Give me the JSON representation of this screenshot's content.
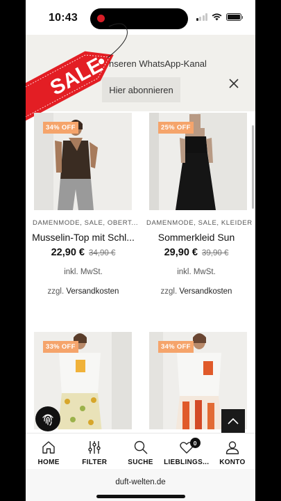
{
  "status": {
    "time": "10:43"
  },
  "banner": {
    "text": "nseren WhatsApp-Kanal",
    "button": "Hier abonnieren"
  },
  "sale_tag": {
    "text": "SALE",
    "colors": {
      "tag": "#e31e24",
      "text": "#ffffff"
    }
  },
  "products": [
    {
      "badge": "34% OFF",
      "category": "DAMENMODE, SALE, OBERT...",
      "name": "Musselin-Top mit Schl...",
      "price": "22,90 €",
      "old_price": "34,90 €",
      "vat": "inkl. MwSt.",
      "ship_prefix": "zzgl.",
      "ship_link": "Versandkosten"
    },
    {
      "badge": "25% OFF",
      "category": "DAMENMODE, SALE, KLEIDER",
      "name": "Sommerkleid Sun",
      "price": "29,90 €",
      "old_price": "39,90 €",
      "vat": "inkl. MwSt.",
      "ship_prefix": "zzgl.",
      "ship_link": "Versandkosten"
    },
    {
      "badge": "33% OFF"
    },
    {
      "badge": "34% OFF"
    }
  ],
  "nav": {
    "items": [
      {
        "label": "HOME",
        "icon": "home-icon"
      },
      {
        "label": "FILTER",
        "icon": "filter-icon"
      },
      {
        "label": "SUCHE",
        "icon": "search-icon"
      },
      {
        "label": "LIEBLINGS...",
        "icon": "heart-icon",
        "count": "0"
      },
      {
        "label": "KONTO",
        "icon": "account-icon"
      }
    ]
  },
  "browser": {
    "url": "duft-welten.de"
  },
  "colors": {
    "badge": "#f5a46b",
    "banner_bg": "#f1f0ec"
  }
}
